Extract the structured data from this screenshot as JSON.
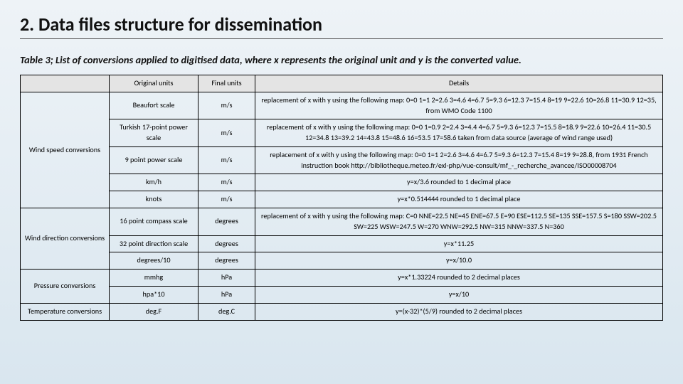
{
  "title": "2. Data files structure for dissemination",
  "caption": "Table 3; List of conversions applied to digitised data, where x represents the original unit and y is the converted value.",
  "headers": {
    "col0": "",
    "col1": "Original units",
    "col2": "Final units",
    "col3": "Details"
  },
  "categories": {
    "windspeed": "Wind speed conversions",
    "winddir": "Wind direction conversions",
    "pressure": "Pressure conversions",
    "temperature": "Temperature conversions"
  },
  "rows": {
    "r0": {
      "orig": "Beaufort scale",
      "final": "m/s",
      "details": "replacement of x with y using the following map: 0=0 1=1 2=2.6 3=4.6 4=6.7 5=9.3 6=12.3 7=15.4 8=19 9=22.6 10=26.8 11=30.9 12=35, from WMO Code 1100"
    },
    "r1": {
      "orig": "Turkish 17-point power scale",
      "final": "m/s",
      "details": "replacement of x with y using the following map: 0=0 1=0.9 2=2.4 3=4.4 4=6.7 5=9.3 6=12.3 7=15.5 8=18.9 9=22.6 10=26.4 11=30.5 12=34.8 13=39.2 14=43.8 15=48.6 16=53.5 17=58.6 taken from data source (average of wind range used)"
    },
    "r2": {
      "orig": "9 point power scale",
      "final": "m/s",
      "details": "replacement of x with y using the following map: 0=0 1=1 2=2.6 3=4.6 4=6.7 5=9.3 6=12.3 7=15.4 8=19 9=28.8, from 1931 French instruction book http://bibliotheque.meteo.fr/exl-php/vue-consult/mf_-_recherche_avancee/ISO00008704"
    },
    "r3": {
      "orig": "km/h",
      "final": "m/s",
      "details": "y=x/3.6 rounded to 1 decimal place"
    },
    "r4": {
      "orig": "knots",
      "final": "m/s",
      "details": "y=x*0.514444 rounded to 1 decimal place"
    },
    "r5": {
      "orig": "16 point compass scale",
      "final": "degrees",
      "details": "replacement of x with y using the following map: C=0 NNE=22.5 NE=45 ENE=67.5 E=90 ESE=112.5 SE=135 SSE=157.5 S=180 SSW=202.5 SW=225 WSW=247.5 W=270 WNW=292.5 NW=315 NNW=337.5 N=360"
    },
    "r6": {
      "orig": "32 point direction scale",
      "final": "degrees",
      "details": "y=x*11.25"
    },
    "r7": {
      "orig": "degrees/10",
      "final": "degrees",
      "details": "y=x/10.0"
    },
    "r8": {
      "orig": "mmhg",
      "final": "hPa",
      "details": "y=x*1.33224 rounded to 2 decimal places"
    },
    "r9": {
      "orig": "hpa*10",
      "final": "hPa",
      "details": "y=x/10"
    },
    "r10": {
      "orig": "deg.F",
      "final": "deg.C",
      "details": "y=(x-32)*(5/9) rounded to 2 decimal places"
    }
  }
}
